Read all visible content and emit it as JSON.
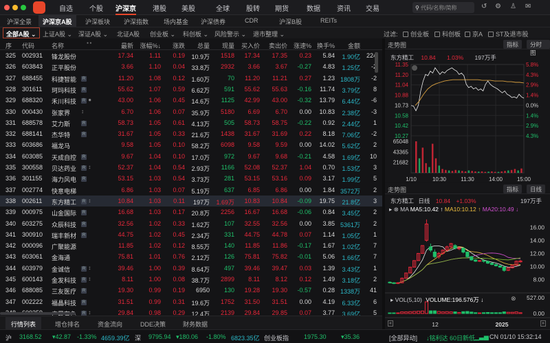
{
  "nav": {
    "items": [
      "自选",
      "个股",
      "沪深京",
      "港股",
      "美股",
      "全球",
      "股转",
      "期货",
      "数据",
      "资讯",
      "交易"
    ],
    "active": "沪深京",
    "search_placeholder": "代码/名称/简称"
  },
  "subtabs": [
    "沪深全景",
    "沪深京A股",
    "沪深板块",
    "沪深指数",
    "场内基金",
    "沪深债券",
    "CDR",
    "沪深B股",
    "REITs"
  ],
  "filters": {
    "items": [
      "全部A股",
      "上证A股",
      "深证A股",
      "北证A股",
      "创业板",
      "科创板",
      "风险警示",
      "退市整理"
    ],
    "label": "过滤:",
    "checks": [
      "创业板",
      "科创板",
      "京A",
      "ST及退市股"
    ]
  },
  "table": {
    "headers": [
      "序",
      "代码",
      "名称",
      "最新",
      "涨幅%↓",
      "涨跌",
      "总量",
      "现量",
      "买入价",
      "卖出价",
      "涨速%",
      "换手%",
      "金额"
    ],
    "rows": [
      [
        "325",
        "002931",
        "锋龙股份",
        "",
        "17.34",
        "1.11",
        "0.19",
        "10.9万",
        "1518",
        "17.34",
        "17.35",
        "0.23",
        "5.84",
        "1.90亿",
        "224"
      ],
      [
        "326",
        "603843",
        "正平股份",
        "",
        "3.66",
        "1.10",
        "0.04",
        "33.8万",
        "2932",
        "3.66",
        "3.67",
        "-0.27",
        "4.83",
        "1.25亿",
        "-2"
      ],
      [
        "327",
        "688455",
        "科捷智能",
        "R",
        "11.20",
        "1.08",
        "0.12",
        "1.60万",
        "70",
        "11.20",
        "11.21",
        "0.27",
        "1.23",
        "1808万",
        "-2"
      ],
      [
        "328",
        "301611",
        "珂玛科技",
        "R",
        "55.62",
        "1.07",
        "0.59",
        "6.62万",
        "591",
        "55.62",
        "55.63",
        "-0.16",
        "11.74",
        "3.79亿",
        "8"
      ],
      [
        "329",
        "688320",
        "禾川科技",
        "R●",
        "43.00",
        "1.06",
        "0.45",
        "14.6万",
        "1125",
        "42.99",
        "43.00",
        "-0.32",
        "13.79",
        "6.44亿",
        "-6"
      ],
      [
        "330",
        "000430",
        "张家界",
        "↕",
        "6.70",
        "1.06",
        "0.07",
        "35.9万",
        "5180",
        "6.69",
        "6.70",
        "0.00",
        "10.83",
        "2.38亿",
        "-3"
      ],
      [
        "331",
        "688578",
        "艾力斯",
        "R",
        "58.73",
        "1.05",
        "0.61",
        "4.13万",
        "505",
        "58.73",
        "58.75",
        "-0.22",
        "0.92",
        "2.44亿",
        "1"
      ],
      [
        "332",
        "688141",
        "杰华特",
        "R",
        "31.67",
        "1.05",
        "0.33",
        "21.6万",
        "1438",
        "31.67",
        "31.69",
        "0.22",
        "8.18",
        "7.06亿",
        "-2"
      ],
      [
        "333",
        "603686",
        "福龙马",
        "",
        "9.58",
        "1.05",
        "0.10",
        "58.2万",
        "6098",
        "9.58",
        "9.59",
        "0.00",
        "14.02",
        "5.62亿",
        "2"
      ],
      [
        "334",
        "603085",
        "天成自控",
        "R",
        "9.67",
        "1.04",
        "0.10",
        "17.0万",
        "972",
        "9.67",
        "9.68",
        "-0.21",
        "4.58",
        "1.69亿",
        "10"
      ],
      [
        "335",
        "300558",
        "贝达药业",
        "R↕",
        "52.37",
        "1.04",
        "0.54",
        "2.93万",
        "1166",
        "52.08",
        "52.37",
        "1.04",
        "0.70",
        "1.53亿",
        "3"
      ],
      [
        "336",
        "301155",
        "海力风电",
        "R",
        "53.15",
        "1.03",
        "0.54",
        "3.73万",
        "281",
        "53.15",
        "53.16",
        "0.09",
        "3.17",
        "1.99亿",
        "5"
      ],
      [
        "337",
        "002774",
        "快意电梯",
        "",
        "6.86",
        "1.03",
        "0.07",
        "5.19万",
        "637",
        "6.85",
        "6.86",
        "0.00",
        "1.84",
        "3572万",
        "2"
      ],
      [
        "338",
        "002611",
        "东方精工",
        "R↕",
        "10.84",
        "1.03",
        "0.11",
        "197万",
        "1.69万",
        "10.83",
        "10.84",
        "-0.09",
        "19.75",
        "21.8亿",
        "3"
      ],
      [
        "339",
        "000975",
        "山金国际",
        "R",
        "16.68",
        "1.03",
        "0.17",
        "20.8万",
        "2256",
        "16.67",
        "16.68",
        "-0.06",
        "0.84",
        "3.45亿",
        "2"
      ],
      [
        "340",
        "603275",
        "众辰科技",
        "R",
        "32.56",
        "1.02",
        "0.33",
        "1.62万",
        "107",
        "32.55",
        "32.56",
        "0.00",
        "3.85",
        "5361万",
        "2"
      ],
      [
        "341",
        "300910",
        "瑞丰新材",
        "R",
        "44.75",
        "1.02",
        "0.45",
        "2.34万",
        "331",
        "44.75",
        "44.78",
        "0.07",
        "1.14",
        "1.05亿",
        "1"
      ],
      [
        "342",
        "000096",
        "广聚能源",
        "",
        "11.85",
        "1.02",
        "0.12",
        "8.55万",
        "140",
        "11.85",
        "11.86",
        "-0.17",
        "1.67",
        "1.02亿",
        "7"
      ],
      [
        "343",
        "603061",
        "金海通",
        "",
        "75.81",
        "1.01",
        "0.76",
        "2.12万",
        "126",
        "75.81",
        "75.82",
        "-0.01",
        "5.06",
        "1.66亿",
        "7"
      ],
      [
        "344",
        "603979",
        "金诚信",
        "R↕",
        "39.46",
        "1.00",
        "0.39",
        "8.64万",
        "497",
        "39.46",
        "39.47",
        "0.03",
        "1.39",
        "3.43亿",
        "1"
      ],
      [
        "345",
        "600143",
        "金发科技",
        "R↕",
        "8.11",
        "1.00",
        "0.08",
        "38.7万",
        "2899",
        "8.11",
        "8.12",
        "0.12",
        "1.49",
        "3.18亿",
        "2"
      ],
      [
        "346",
        "688085",
        "三友医疗",
        "R",
        "19.30",
        "0.99",
        "0.19",
        "6950",
        "130",
        "19.28",
        "19.30",
        "-0.57",
        "0.28",
        "1338万",
        "41"
      ],
      [
        "347",
        "002222",
        "福晶科技",
        "R",
        "31.51",
        "0.99",
        "0.31",
        "19.6万",
        "1752",
        "31.50",
        "31.51",
        "0.00",
        "4.19",
        "6.33亿",
        "6"
      ],
      [
        "348",
        "600259",
        "广晟有色",
        "R↕",
        "29.84",
        "0.98",
        "0.29",
        "12.4万",
        "2139",
        "29.84",
        "29.85",
        "0.07",
        "3.77",
        "3.69亿",
        "5"
      ]
    ],
    "selected": "338"
  },
  "bottom_tabs": [
    "行情列表",
    "增仓排名",
    "资金流向",
    "DDE决策",
    "财务数据"
  ],
  "intraday": {
    "title": "走势图",
    "btn_indicator": "指标",
    "btn_mode": "分时图",
    "name": "东方精工",
    "price": "10.84",
    "pct": "1.03%",
    "vol": "197万手",
    "price_ticks": [
      "11.35",
      "11.20",
      "11.04",
      "10.88",
      "10.73",
      "10.58",
      "10.42",
      "10.27"
    ],
    "pct_ticks": [
      "5.8%",
      "4.3%",
      "2.9%",
      "1.4%",
      "0.0%",
      "1.4%",
      "2.9%",
      "4.3%"
    ],
    "vol_ticks": [
      "65048",
      "43365",
      "21682"
    ],
    "time_ticks": [
      "1/10",
      "10:30",
      "11:30",
      "14:00",
      "15:00"
    ]
  },
  "chart_data": [
    {
      "type": "line",
      "title": "东方精工 分时",
      "ylim": [
        10.27,
        11.35
      ],
      "price": [
        10.73,
        10.72,
        10.65,
        10.73,
        10.95,
        11.1,
        11.2,
        11.18,
        11.25,
        11.22,
        11.3,
        11.25,
        11.2,
        11.24,
        11.22,
        11.26,
        11.28,
        11.3,
        11.27,
        11.25,
        11.2,
        11.22,
        11.18,
        11.05,
        11.0,
        11.02,
        10.98,
        11.0,
        10.96,
        10.98,
        10.95,
        11.05,
        11.1,
        11.05,
        11.02,
        11.0,
        10.98,
        10.95,
        10.92,
        10.95,
        10.9,
        10.88,
        10.85,
        10.86,
        10.84,
        10.9,
        10.86,
        10.84
      ],
      "avg": [
        10.73,
        10.8,
        10.9,
        10.98,
        11.03,
        11.06,
        11.08,
        11.1,
        11.11,
        11.12,
        11.12,
        11.12,
        11.12,
        11.12,
        11.12,
        11.12,
        11.11,
        11.11,
        11.11,
        11.1,
        11.1,
        11.1,
        11.09,
        11.09,
        11.08,
        11.08,
        11.07
      ],
      "volume": [
        65048,
        30000,
        52000,
        20000,
        12000,
        60000,
        30000,
        15000,
        8000,
        6000,
        5000,
        4000,
        6000,
        5000,
        4000,
        3000,
        5000,
        4000,
        3000,
        2500,
        3000,
        2000,
        2500,
        3000,
        2000,
        2000,
        3000,
        4000,
        5000,
        6000,
        8000,
        5000,
        9000
      ]
    },
    {
      "type": "candlestick",
      "title": "东方精工 日线",
      "ylim": [
        7,
        17.5
      ],
      "ohlc": [
        [
          7.6,
          7.7,
          7.4,
          7.5
        ],
        [
          7.5,
          7.6,
          7.3,
          7.4
        ],
        [
          7.4,
          7.6,
          7.3,
          7.5
        ],
        [
          7.5,
          8.3,
          7.5,
          8.2
        ],
        [
          8.2,
          9.0,
          8.2,
          9.0
        ],
        [
          9.0,
          9.9,
          9.0,
          9.9
        ],
        [
          9.9,
          10.9,
          9.9,
          10.9
        ],
        [
          10.9,
          12.0,
          10.9,
          12.0
        ],
        [
          12.0,
          13.2,
          12.0,
          13.2
        ],
        [
          14.0,
          17.2,
          13.8,
          16.5
        ],
        [
          13.0,
          13.5,
          12.2,
          12.5
        ],
        [
          12.2,
          12.6,
          11.3,
          11.5
        ],
        [
          11.5,
          12.2,
          11.2,
          12.0
        ],
        [
          12.0,
          12.6,
          11.8,
          12.5
        ],
        [
          12.5,
          13.2,
          12.3,
          13.0
        ],
        [
          13.0,
          13.6,
          12.8,
          13.5
        ],
        [
          13.2,
          13.4,
          12.6,
          12.8
        ],
        [
          12.8,
          13.0,
          12.5,
          12.8
        ],
        [
          12.8,
          12.9,
          12.0,
          12.2
        ],
        [
          12.2,
          12.3,
          11.3,
          11.5
        ],
        [
          11.5,
          11.6,
          10.9,
          11.0
        ],
        [
          11.0,
          11.1,
          10.7,
          10.8
        ],
        [
          10.8,
          11.0,
          10.7,
          10.9
        ],
        [
          10.9,
          11.0,
          10.6,
          10.8
        ],
        [
          10.8,
          10.9,
          10.4,
          10.5
        ],
        [
          10.5,
          10.6,
          10.2,
          10.3
        ],
        [
          10.3,
          10.4,
          10.0,
          10.1
        ],
        [
          10.1,
          10.2,
          9.8,
          9.9
        ],
        [
          9.9,
          10.0,
          9.2,
          9.4
        ],
        [
          9.4,
          9.9,
          9.3,
          9.8
        ],
        [
          9.8,
          10.3,
          9.7,
          10.2
        ],
        [
          10.2,
          10.9,
          10.1,
          10.8
        ],
        [
          10.7,
          11.0,
          10.6,
          10.84
        ]
      ],
      "ma_labels": {
        "ma": "MA",
        "ma5": "MA5:10.42",
        "ma10": "MA10:10.12",
        "ma20": "MA20:10.49"
      },
      "price_ticks": [
        "16.00",
        "14.00",
        "12.00",
        "10.00",
        "8.00"
      ],
      "vol_label": "VOL(5,10)",
      "volume_text": "VOLUME:196.576万",
      "vol_ticks": [
        "527.00",
        "0.00"
      ],
      "x_ticks": [
        "12",
        "2025"
      ]
    }
  ],
  "daily": {
    "title": "走势图",
    "btn_indicator": "指标",
    "btn_mode": "日线",
    "name": "东方精工",
    "period": "日线",
    "price": "10.84",
    "pct": "+1.03%",
    "vol": "197万手"
  },
  "status": {
    "sh_label": "沪",
    "sh": "3168.52",
    "sh_chg": "▾42.87",
    "sh_pct": "-1.33%",
    "sh_amt": "4659.39亿",
    "sz_label": "深",
    "sz": "9795.94",
    "sz_chg": "▾180.06",
    "sz_pct": "-1.80%",
    "sz_amt": "6823.35亿",
    "cy_label": "创业板指",
    "cy": "1975.30",
    "cy_chg": "▾35.36",
    "alert": "[全部异动]",
    "news": "↓铭利达 60日新低",
    "clock": "CN 01/10 15:32:14"
  },
  "colors": {
    "up": "#e8283a",
    "down": "#1fbf6a",
    "accent": "#e8462a"
  }
}
